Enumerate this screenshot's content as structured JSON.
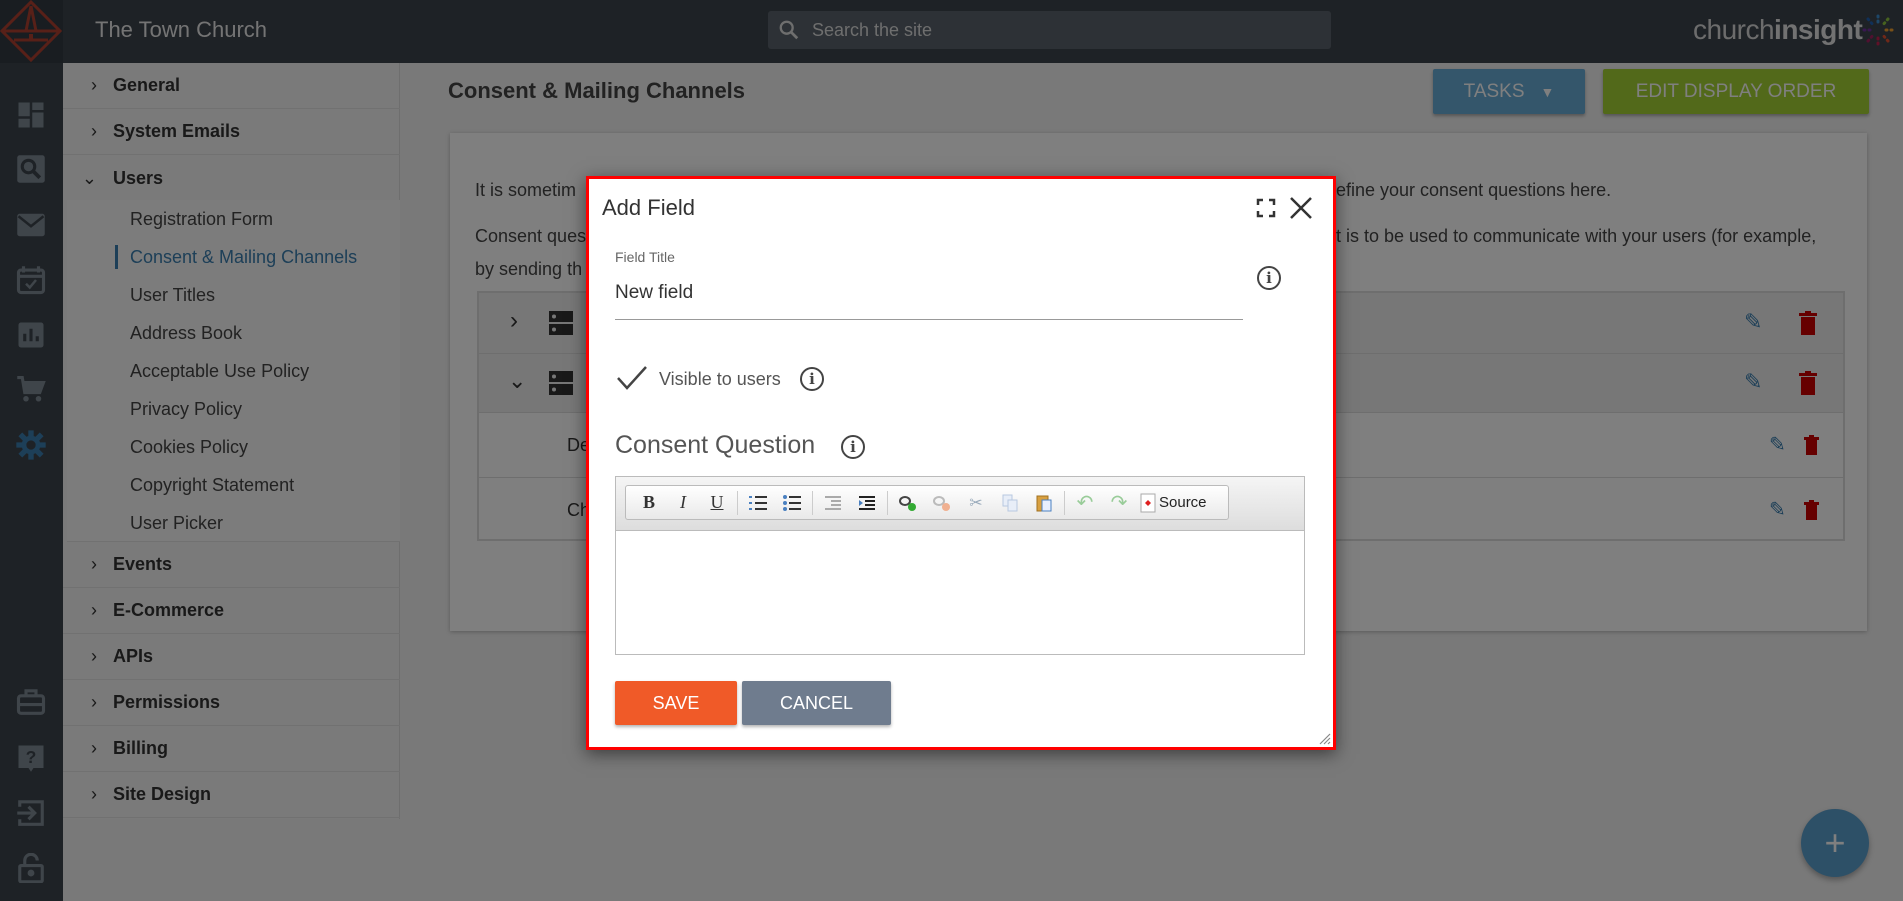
{
  "header": {
    "site_title": "The Town Church",
    "search_placeholder": "Search the site",
    "brand_light": "church",
    "brand_bold": "insight"
  },
  "rail": {
    "top_icons": [
      "dashboard-icon",
      "search-icon",
      "mail-icon",
      "calendar-icon",
      "chart-icon",
      "cart-icon",
      "gear-icon"
    ],
    "bottom_icons": [
      "briefcase-icon",
      "help-icon",
      "sign-in-icon",
      "lock-icon"
    ],
    "active_color": "#3a7fb0"
  },
  "settings_nav": {
    "sections_top": [
      "General",
      "System Emails"
    ],
    "expanded": "Users",
    "users_items": [
      "Registration Form",
      "Consent & Mailing Channels",
      "User Titles",
      "Address Book",
      "Acceptable Use Policy",
      "Privacy Policy",
      "Cookies Policy",
      "Copyright Statement",
      "User Picker"
    ],
    "active_item": "Consent & Mailing Channels",
    "sections_bottom": [
      "Events",
      "E-Commerce",
      "APIs",
      "Permissions",
      "Billing",
      "Site Design"
    ]
  },
  "main": {
    "title": "Consent & Mailing Channels",
    "tasks_label": "TASKS",
    "edit_order_label": "EDIT DISPLAY ORDER",
    "intro_1a": "It is sometim",
    "intro_1b": "efine your consent questions here.",
    "intro_2a": "Consent ques",
    "intro_2b": "t is to be used to communicate with your users (for example,",
    "intro_3a": "by sending th",
    "rows": [
      {
        "label": ""
      },
      {
        "label": ""
      },
      {
        "label": "De"
      },
      {
        "label": "Ch"
      }
    ]
  },
  "modal": {
    "title": "Add Field",
    "field_title_label": "Field Title",
    "field_title_value": "New field",
    "visible_label": "Visible to users",
    "visible_checked": true,
    "consent_heading": "Consent Question",
    "toolbar": {
      "bold": "B",
      "italic": "I",
      "underline": "U",
      "source": "Source"
    },
    "save_label": "SAVE",
    "cancel_label": "CANCEL"
  },
  "colors": {
    "save": "#f05a28",
    "cancel": "#6f7c8e",
    "tasks": "#68acd6",
    "edit_order": "#a4d234",
    "modal_border": "#ff0000"
  }
}
